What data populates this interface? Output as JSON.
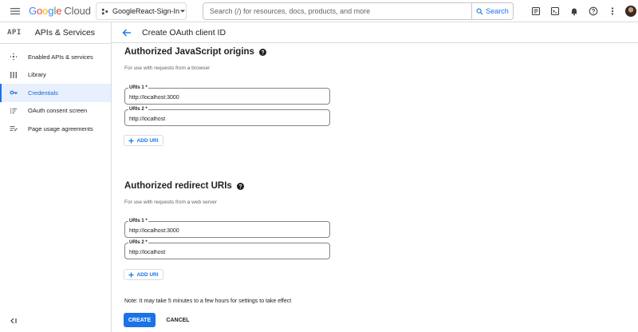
{
  "colors": {
    "accent": "#1a73e8",
    "active_bg": "#e8f0fe",
    "border": "#dadce0",
    "text": "#202124",
    "muted": "#5f6368"
  },
  "header": {
    "logo_google": "Google",
    "logo_cloud": "Cloud",
    "project_label": "GoogleReact-Sign-In",
    "search_placeholder": "Search (/) for resources, docs, products, and more",
    "search_button": "Search",
    "icons": [
      "menu-icon",
      "project-icon",
      "search-icon",
      "notes-icon",
      "terminal-icon",
      "bell-icon",
      "help-icon",
      "more-vert-icon"
    ]
  },
  "sidebar": {
    "badge": "API",
    "title": "APIs & Services",
    "items": [
      {
        "label": "Enabled APIs & services",
        "icon": "apis-icon",
        "active": false
      },
      {
        "label": "Library",
        "icon": "library-icon",
        "active": false
      },
      {
        "label": "Credentials",
        "icon": "key-icon",
        "active": true
      },
      {
        "label": "OAuth consent screen",
        "icon": "consent-icon",
        "active": false
      },
      {
        "label": "Page usage agreements",
        "icon": "agreements-icon",
        "active": false
      }
    ],
    "collapse_icon": "collapse-icon"
  },
  "page": {
    "title": "Create OAuth client ID"
  },
  "origins": {
    "title": "Authorized JavaScript origins",
    "desc": "For use with requests from a browser",
    "fields": [
      {
        "label": "URIs 1 *",
        "value": "http://localhost:3000"
      },
      {
        "label": "URIs 2 *",
        "value": "http://localhost"
      }
    ],
    "add_label": "ADD URI"
  },
  "redirects": {
    "title": "Authorized redirect URIs",
    "desc": "For use with requests from a web server",
    "fields": [
      {
        "label": "URIs 1 *",
        "value": "http://localhost:3000"
      },
      {
        "label": "URIs 2 *",
        "value": "http://localhost"
      }
    ],
    "add_label": "ADD URI"
  },
  "note": "Note: It may take 5 minutes to a few hours for settings to take effect",
  "actions": {
    "create": "CREATE",
    "cancel": "CANCEL"
  }
}
